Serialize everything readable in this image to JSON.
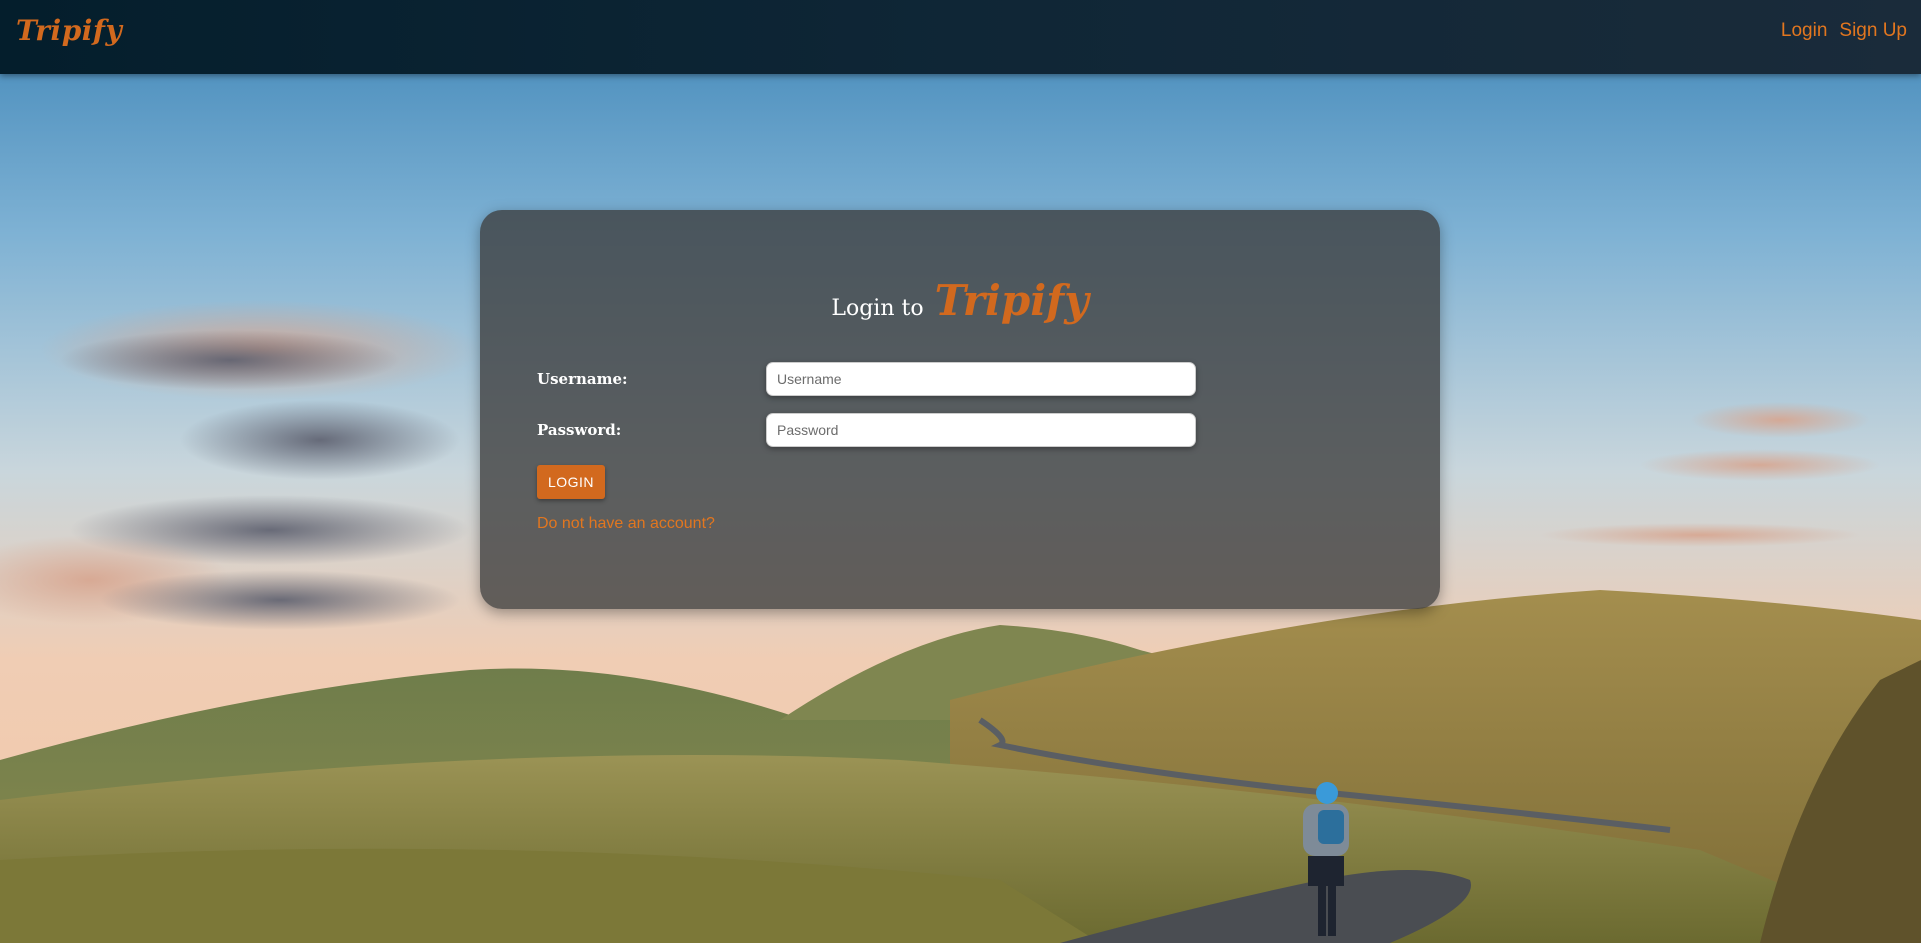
{
  "navbar": {
    "brand": "Tripify",
    "links": [
      {
        "label": "Login"
      },
      {
        "label": "Sign Up"
      }
    ]
  },
  "login_card": {
    "title_prefix": "Login to",
    "title_brand": "Tripify",
    "username": {
      "label": "Username:",
      "placeholder": "Username",
      "value": ""
    },
    "password": {
      "label": "Password:",
      "placeholder": "Password",
      "value": ""
    },
    "submit_label": "LOGIN",
    "signup_link": "Do not have an account?"
  },
  "colors": {
    "accent": "#d2691e",
    "navbar": "#0f2636",
    "card": "#3c3c3c"
  },
  "background": {
    "icon": "landscape-photo"
  }
}
